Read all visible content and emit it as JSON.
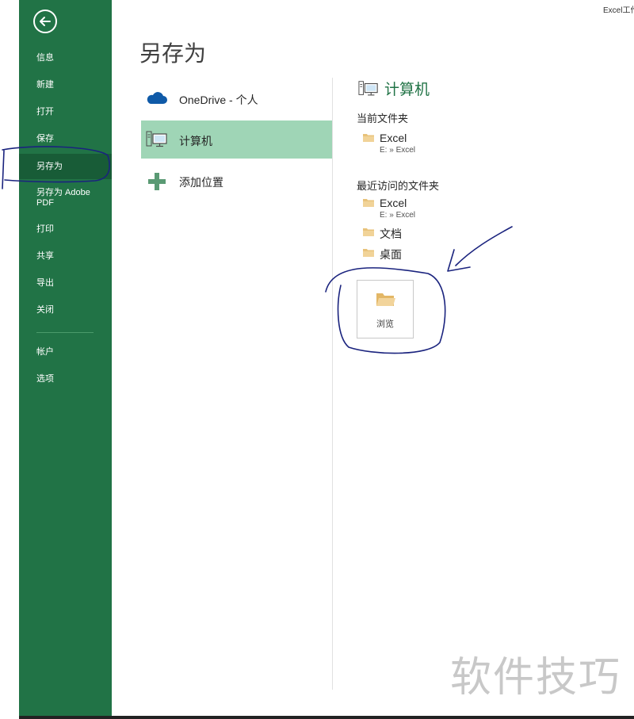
{
  "window": {
    "title": "Excel工作"
  },
  "sidebar": {
    "items": [
      {
        "label": "信息"
      },
      {
        "label": "新建"
      },
      {
        "label": "打开"
      },
      {
        "label": "保存"
      },
      {
        "label": "另存为",
        "selected": true
      },
      {
        "label": "另存为 Adobe PDF"
      },
      {
        "label": "打印"
      },
      {
        "label": "共享"
      },
      {
        "label": "导出"
      },
      {
        "label": "关闭"
      },
      {
        "label": "帐户"
      },
      {
        "label": "选项"
      }
    ]
  },
  "main": {
    "title": "另存为",
    "places": [
      {
        "label": "OneDrive - 个人",
        "icon": "cloud-icon"
      },
      {
        "label": "计算机",
        "icon": "computer-icon",
        "selected": true
      },
      {
        "label": "添加位置",
        "icon": "plus-icon"
      }
    ]
  },
  "right": {
    "title": "计算机",
    "current_label": "当前文件夹",
    "current_folders": [
      {
        "name": "Excel",
        "path": "E: » Excel"
      }
    ],
    "recent_label": "最近访问的文件夹",
    "recent_folders": [
      {
        "name": "Excel",
        "path": "E: » Excel"
      },
      {
        "name": "文档"
      },
      {
        "name": "桌面"
      }
    ],
    "browse_label": "浏览"
  },
  "watermark": "软件技巧",
  "colors": {
    "accent": "#217346",
    "accent_dark": "#185c37",
    "selected_bg": "#9fd5b6",
    "folder": "#e8c27a",
    "annotation_ink": "#1a237e"
  }
}
